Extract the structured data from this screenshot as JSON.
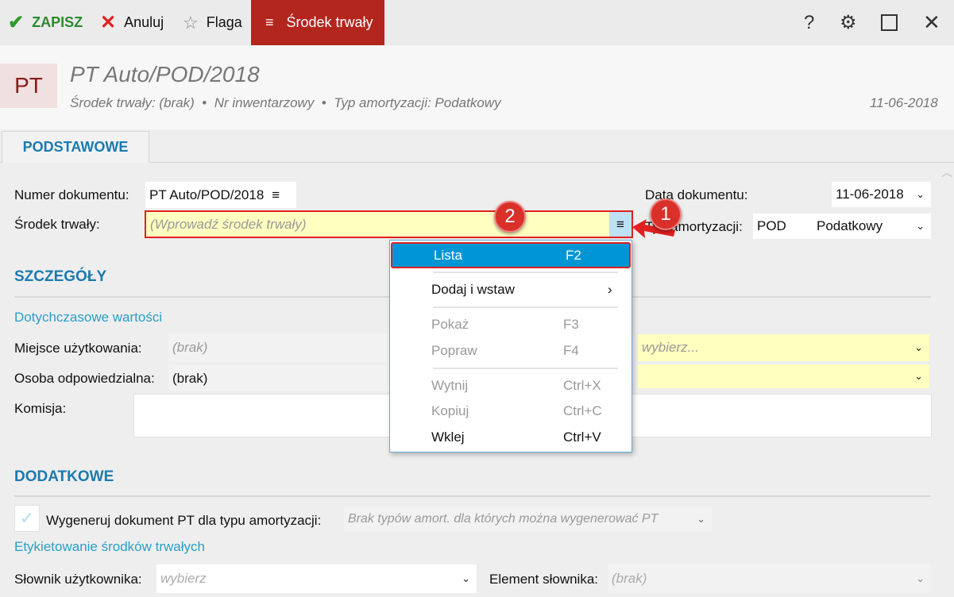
{
  "toolbar": {
    "save": "ZAPISZ",
    "cancel": "Anuluj",
    "flag": "Flaga",
    "active_tab": "Środek trwały",
    "accent": "#b3261e"
  },
  "header": {
    "badge": "PT",
    "title": "PT Auto/POD/2018",
    "sub1": "Środek trwały: (brak)",
    "sub2": "Nr inwentarzowy",
    "sub3": "Typ amortyzacji: Podatkowy",
    "date": "11-06-2018"
  },
  "tabs": [
    "PODSTAWOWE"
  ],
  "form": {
    "numer_label": "Numer dokumentu:",
    "numer_value": "PT Auto/POD/2018",
    "srodek_label": "Środek trwały:",
    "srodek_placeholder": "(Wprowadź środek trwały)",
    "data_label": "Data dokumentu:",
    "data_value": "11-06-2018",
    "typ_label": "Typ amortyzacji:",
    "typ_code": "POD",
    "typ_name": "Podatkowy"
  },
  "szczegoly": {
    "title": "SZCZEGÓŁY",
    "link": "Dotychczasowe wartości",
    "miejsce_label": "Miejsce użytkowania:",
    "miejsce_value": "(brak)",
    "miejsce_right_placeholder": "wybierz...",
    "osoba_label": "Osoba odpowiedzialna:",
    "osoba_value": "(brak)",
    "komisja_label": "Komisja:"
  },
  "dodatkowe": {
    "title": "DODATKOWE",
    "checkbox_label": "Wygeneruj dokument PT dla typu amortyzacji:",
    "checkbox_select": "Brak typów amort. dla których można wygenerować PT",
    "link": "Etykietowanie środków trwałych",
    "slownik_label": "Słownik użytkownika:",
    "slownik_placeholder": "wybierz",
    "element_label": "Element słownika:",
    "element_value": "(brak)"
  },
  "menu": {
    "items": [
      {
        "label": "Lista",
        "shortcut": "F2"
      },
      {
        "label": "Dodaj i wstaw",
        "shortcut": "›"
      },
      {
        "label": "Pokaż",
        "shortcut": "F3"
      },
      {
        "label": "Popraw",
        "shortcut": "F4"
      },
      {
        "label": "Wytnij",
        "shortcut": "Ctrl+X"
      },
      {
        "label": "Kopiuj",
        "shortcut": "Ctrl+C"
      },
      {
        "label": "Wklej",
        "shortcut": "Ctrl+V"
      }
    ]
  },
  "annotations": {
    "b1": "1",
    "b2": "2"
  }
}
